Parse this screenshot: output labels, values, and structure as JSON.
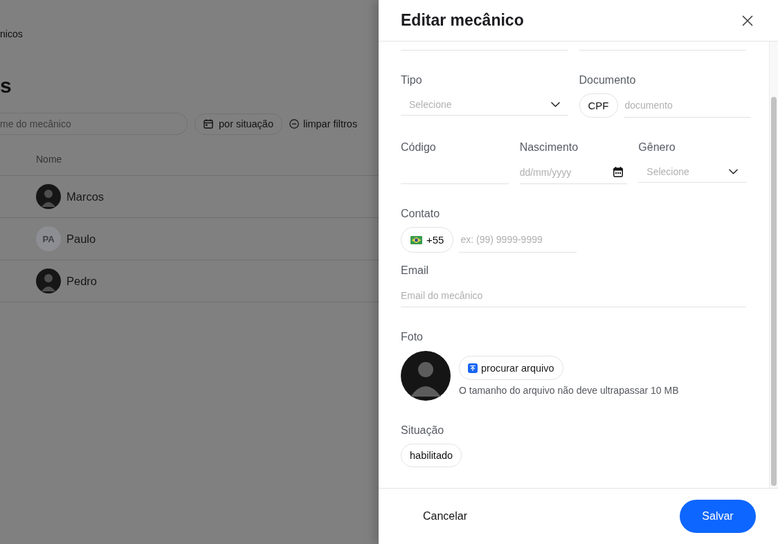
{
  "background_page": {
    "breadcrumb": "nicos",
    "title": "s",
    "search": {
      "placeholder": "me do mecânico"
    },
    "filters": [
      {
        "kind": "dropdown",
        "label": "por situação"
      },
      {
        "kind": "clear",
        "label": "limpar filtros"
      }
    ],
    "table": {
      "columns": [
        "Nome"
      ],
      "rows": [
        {
          "avatar": {
            "kind": "photo"
          },
          "name": "Marcos"
        },
        {
          "avatar": {
            "kind": "initials",
            "initials": "PA"
          },
          "name": "Paulo"
        },
        {
          "avatar": {
            "kind": "photo"
          },
          "name": "Pedro"
        }
      ]
    }
  },
  "drawer": {
    "title": "Editar mecânico",
    "rows": [
      {
        "fields": [
          {
            "kind": "text"
          },
          {
            "kind": "text"
          }
        ]
      },
      {
        "fields": [
          {
            "label": "Tipo",
            "kind": "select",
            "placeholder": "Selecione"
          },
          {
            "label": "Documento",
            "kind": "document",
            "prefix": "CPF",
            "placeholder": "documento"
          }
        ]
      },
      {
        "fields": [
          {
            "label": "Código",
            "kind": "text"
          },
          {
            "label": "Nascimento",
            "kind": "date",
            "placeholder": "dd/mm/yyyy"
          },
          {
            "label": "Gênero",
            "kind": "select",
            "placeholder": "Selecione"
          }
        ]
      },
      {
        "fields": [
          {
            "label": "Contato",
            "kind": "phone",
            "prefix": "+55",
            "placeholder": "ex: (99) 9999-9999"
          }
        ]
      },
      {
        "fields": [
          {
            "label": "Email",
            "kind": "text",
            "placeholder": "Email do mecânico"
          }
        ]
      },
      {
        "fields": [
          {
            "label": "Foto",
            "kind": "photo",
            "button": "procurar arquivo",
            "hint": "O tamanho do arquivo não deve ultrapassar 10 MB"
          }
        ]
      },
      {
        "fields": [
          {
            "label": "Situação",
            "kind": "status",
            "value": "habilitado"
          }
        ]
      }
    ],
    "footer": {
      "cancel": "Cancelar",
      "save": "Salvar"
    }
  }
}
